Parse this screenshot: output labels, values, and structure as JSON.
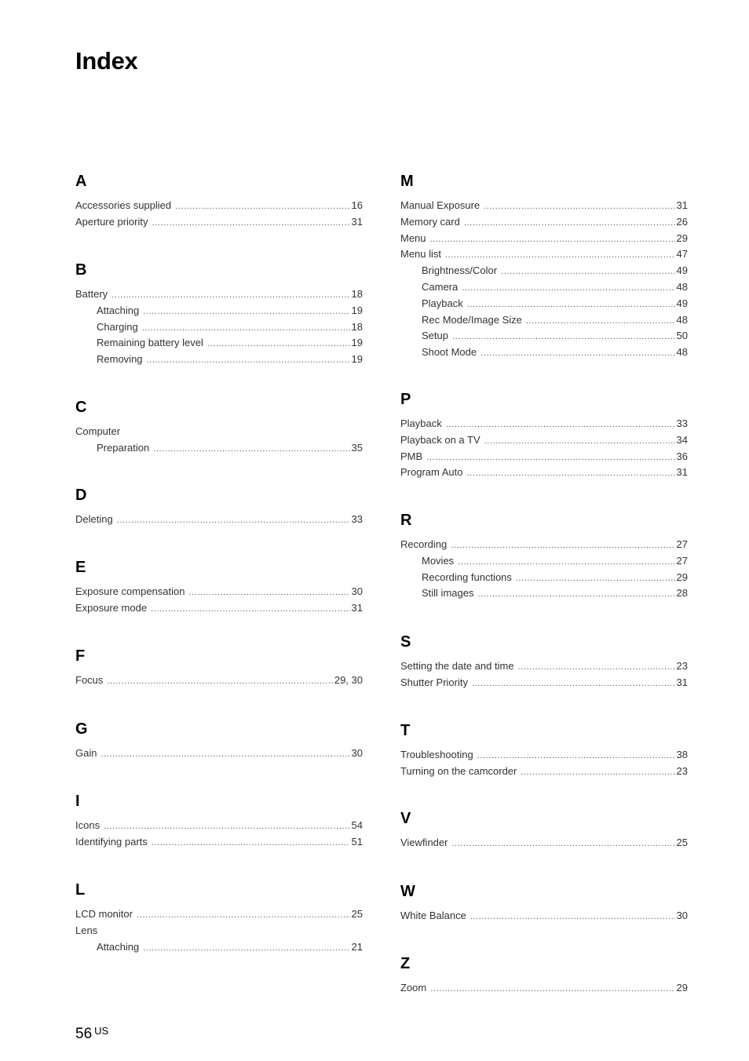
{
  "title": "Index",
  "left_column": [
    {
      "letter": "A",
      "entries": [
        {
          "label": "Accessories supplied",
          "page": "16",
          "sub": false
        },
        {
          "label": "Aperture priority",
          "page": "31",
          "sub": false
        }
      ]
    },
    {
      "letter": "B",
      "entries": [
        {
          "label": "Battery",
          "page": "18",
          "sub": false
        },
        {
          "label": "Attaching",
          "page": "19",
          "sub": true
        },
        {
          "label": "Charging",
          "page": "18",
          "sub": true
        },
        {
          "label": "Remaining battery level",
          "page": "19",
          "sub": true
        },
        {
          "label": "Removing",
          "page": "19",
          "sub": true
        }
      ]
    },
    {
      "letter": "C",
      "entries": [
        {
          "label": "Computer",
          "page": "",
          "sub": false
        },
        {
          "label": "Preparation",
          "page": "35",
          "sub": true
        }
      ]
    },
    {
      "letter": "D",
      "entries": [
        {
          "label": "Deleting",
          "page": "33",
          "sub": false
        }
      ]
    },
    {
      "letter": "E",
      "entries": [
        {
          "label": "Exposure compensation",
          "page": "30",
          "sub": false
        },
        {
          "label": "Exposure mode",
          "page": "31",
          "sub": false
        }
      ]
    },
    {
      "letter": "F",
      "entries": [
        {
          "label": "Focus",
          "page": "29, 30",
          "sub": false
        }
      ]
    },
    {
      "letter": "G",
      "entries": [
        {
          "label": "Gain",
          "page": "30",
          "sub": false
        }
      ]
    },
    {
      "letter": "I",
      "entries": [
        {
          "label": "Icons",
          "page": "54",
          "sub": false
        },
        {
          "label": "Identifying parts",
          "page": "51",
          "sub": false
        }
      ]
    },
    {
      "letter": "L",
      "entries": [
        {
          "label": "LCD monitor",
          "page": "25",
          "sub": false
        },
        {
          "label": "Lens",
          "page": "",
          "sub": false
        },
        {
          "label": "Attaching",
          "page": "21",
          "sub": true
        }
      ]
    }
  ],
  "right_column": [
    {
      "letter": "M",
      "entries": [
        {
          "label": "Manual Exposure",
          "page": "31",
          "sub": false
        },
        {
          "label": "Memory card",
          "page": "26",
          "sub": false
        },
        {
          "label": "Menu",
          "page": "29",
          "sub": false
        },
        {
          "label": "Menu list",
          "page": "47",
          "sub": false
        },
        {
          "label": "Brightness/Color",
          "page": "49",
          "sub": true
        },
        {
          "label": "Camera",
          "page": "48",
          "sub": true
        },
        {
          "label": "Playback",
          "page": "49",
          "sub": true
        },
        {
          "label": "Rec Mode/Image Size",
          "page": "48",
          "sub": true
        },
        {
          "label": "Setup",
          "page": "50",
          "sub": true
        },
        {
          "label": "Shoot Mode",
          "page": "48",
          "sub": true
        }
      ]
    },
    {
      "letter": "P",
      "entries": [
        {
          "label": "Playback",
          "page": "33",
          "sub": false
        },
        {
          "label": "Playback on a TV",
          "page": "34",
          "sub": false
        },
        {
          "label": "PMB",
          "page": "36",
          "sub": false
        },
        {
          "label": "Program Auto",
          "page": "31",
          "sub": false
        }
      ]
    },
    {
      "letter": "R",
      "entries": [
        {
          "label": "Recording",
          "page": "27",
          "sub": false
        },
        {
          "label": "Movies",
          "page": "27",
          "sub": true
        },
        {
          "label": "Recording functions",
          "page": "29",
          "sub": true
        },
        {
          "label": "Still images",
          "page": "28",
          "sub": true
        }
      ]
    },
    {
      "letter": "S",
      "entries": [
        {
          "label": "Setting the date and time",
          "page": "23",
          "sub": false
        },
        {
          "label": "Shutter Priority",
          "page": "31",
          "sub": false
        }
      ]
    },
    {
      "letter": "T",
      "entries": [
        {
          "label": "Troubleshooting",
          "page": "38",
          "sub": false
        },
        {
          "label": "Turning on the camcorder",
          "page": "23",
          "sub": false
        }
      ]
    },
    {
      "letter": "V",
      "entries": [
        {
          "label": "Viewfinder",
          "page": "25",
          "sub": false
        }
      ]
    },
    {
      "letter": "W",
      "entries": [
        {
          "label": "White Balance",
          "page": "30",
          "sub": false
        }
      ]
    },
    {
      "letter": "Z",
      "entries": [
        {
          "label": "Zoom",
          "page": "29",
          "sub": false
        }
      ]
    }
  ],
  "footer": {
    "page_number": "56",
    "region": "US"
  }
}
